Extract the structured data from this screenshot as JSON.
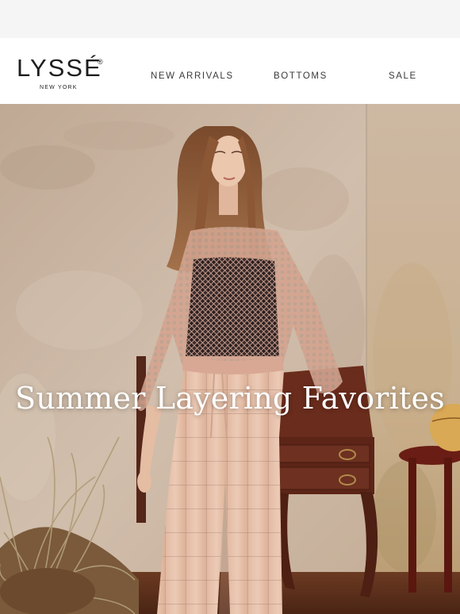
{
  "brand": {
    "name": "LYSSÉ",
    "registered_mark": "®",
    "location": "NEW YORK"
  },
  "nav": {
    "items": [
      {
        "label": "NEW ARRIVALS"
      },
      {
        "label": "BOTTOMS"
      },
      {
        "label": "SALE"
      }
    ]
  },
  "hero": {
    "title": "Summer Layering Favorites",
    "image_alt": "Model wearing open-knit pink sweater over black top and checked wide-leg trousers"
  },
  "colors": {
    "wall": "#cbb6a3",
    "sweater": "#d9a894",
    "pants": "#e8c3ad",
    "wood": "#5a2418"
  }
}
